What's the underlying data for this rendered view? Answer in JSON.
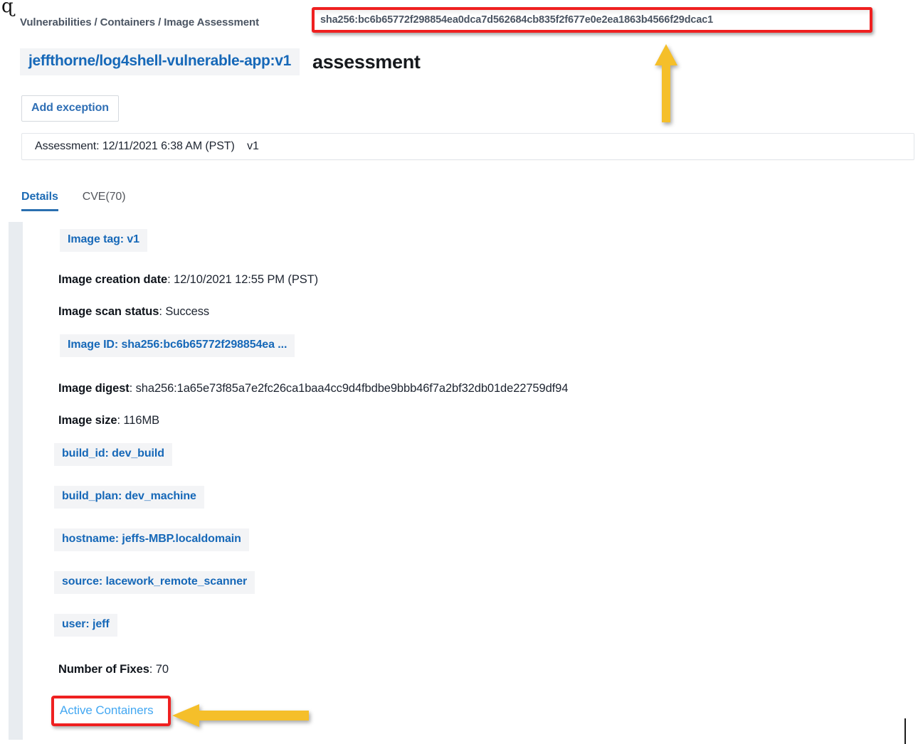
{
  "artifact": {
    "glyph": "ɋ"
  },
  "breadcrumb": {
    "path": "Vulnerabilities / Containers / Image Assessment",
    "sha": "sha256:bc6b65772f298854ea0dca7d562684cb835f2f677e0e2ea1863b4566f29dcac1"
  },
  "header": {
    "image_chip": "jeffthorne/log4shell-vulnerable-app:v1",
    "title_suffix": "assessment"
  },
  "toolbar": {
    "add_exception_label": "Add exception"
  },
  "assessment": {
    "summary": "Assessment: 12/11/2021 6:38 AM (PST)    v1"
  },
  "tabs": [
    {
      "label": "Details",
      "active": true
    },
    {
      "label": "CVE(70)",
      "active": false
    }
  ],
  "details": {
    "image_tag_chip": "Image tag: v1",
    "creation_date_label": "Image creation date",
    "creation_date_value": ": 12/10/2021 12:55 PM (PST)",
    "scan_status_label": "Image scan status",
    "scan_status_value": ": Success",
    "image_id_chip": "Image ID: sha256:bc6b65772f298854ea ...",
    "digest_label": "Image digest",
    "digest_value": ": sha256:1a65e73f85a7e2fc26ca1baa4cc9d4fbdbe9bbb46f7a2bf32db01de22759df94",
    "size_label": "Image size",
    "size_value": ": 116MB",
    "tag_chips": [
      "build_id: dev_build",
      "build_plan: dev_machine",
      "hostname: jeffs-MBP.localdomain",
      "source: lacework_remote_scanner",
      "user: jeff"
    ],
    "fixes_label": "Number of Fixes",
    "fixes_value": ": 70",
    "active_containers_link": "Active Containers"
  },
  "annotations": {
    "highlight_color": "#ef2020",
    "arrow_color": "#f5bf2a",
    "arrow_up_name": "arrow-pointing-to-image-sha",
    "arrow_left_name": "arrow-pointing-to-active-containers"
  },
  "colors": {
    "link_blue": "#1668b8",
    "tab_blue": "#2a6fb0",
    "light_link_blue": "#44a8f2",
    "chip_bg": "#f3f4f6",
    "rail_gray": "#e8ecf0"
  }
}
